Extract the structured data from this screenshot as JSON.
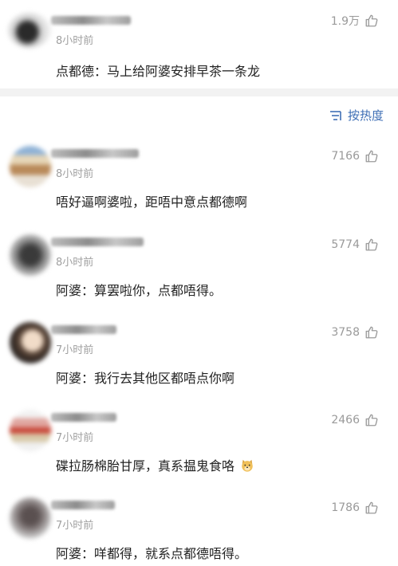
{
  "top_comment": {
    "time": "8小时前",
    "likes": "1.9万",
    "text": "点都德：马上给阿婆安排早茶一条龙"
  },
  "sort": {
    "label": "按热度",
    "icon": "sort-lines-icon"
  },
  "comments": [
    {
      "time": "8小时前",
      "likes": "7166",
      "text": "唔好逼啊婆啦，距唔中意点都德啊"
    },
    {
      "time": "8小时前",
      "likes": "5774",
      "text": "阿婆：算罢啦你，点都唔得。"
    },
    {
      "time": "7小时前",
      "likes": "3758",
      "text": "阿婆：我行去其他区都唔点你啊"
    },
    {
      "time": "7小时前",
      "likes": "2466",
      "text": "碟拉肠棉胎甘厚，真系揾鬼食咯",
      "emoji": "doge-emoji-icon"
    },
    {
      "time": "7小时前",
      "likes": "1786",
      "text": "阿婆：咩都得，就系点都德唔得。"
    }
  ],
  "colors": {
    "accent": "#3f6fb5",
    "meta": "#a0a0a0",
    "divider": "#f2f2f2"
  }
}
